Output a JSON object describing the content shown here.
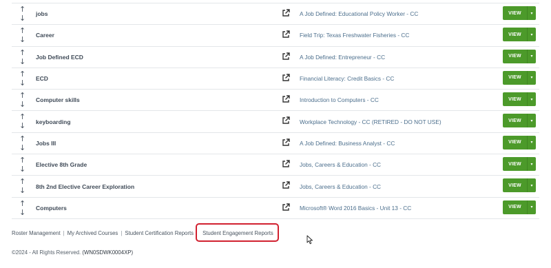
{
  "rows": [
    {
      "name": "jobs",
      "course": "A Job Defined: Educational Policy Worker - CC",
      "view_label": "VIEW"
    },
    {
      "name": "Career",
      "course": "Field Trip: Texas Freshwater Fisheries - CC",
      "view_label": "VIEW"
    },
    {
      "name": "Job Defined ECD",
      "course": "A Job Defined: Entrepreneur - CC",
      "view_label": "VIEW"
    },
    {
      "name": "ECD",
      "course": "Financial Literacy: Credit Basics - CC",
      "view_label": "VIEW"
    },
    {
      "name": "Computer skills",
      "course": "Introduction to Computers - CC",
      "view_label": "VIEW"
    },
    {
      "name": "keyboarding",
      "course": "Workplace Technology - CC (RETIRED - DO NOT USE)",
      "view_label": "VIEW"
    },
    {
      "name": "Jobs III",
      "course": "A Job Defined: Business Analyst - CC",
      "view_label": "VIEW"
    },
    {
      "name": "Elective 8th Grade",
      "course": "Jobs, Careers & Education - CC",
      "view_label": "VIEW"
    },
    {
      "name": "8th 2nd Elective Career Exploration",
      "course": "Jobs, Careers & Education - CC",
      "view_label": "VIEW"
    },
    {
      "name": "Computers",
      "course": "Microsoft® Word 2016 Basics - Unit 13 - CC",
      "view_label": "VIEW"
    }
  ],
  "icons": {
    "sort_up": "↑",
    "sort_down": "↓",
    "external": "external-link-icon",
    "caret": "▾"
  },
  "footer": {
    "links": [
      "Roster Management",
      "My Archived Courses",
      "Student Certification Reports",
      "Student Engagement Reports"
    ],
    "separator": "|",
    "copyright": "©2024 - All Rights Reserved.",
    "code": "(WN0SDWK0004XP)"
  },
  "colors": {
    "view_button": "#4c9a2a",
    "course_link": "#4b6e8c",
    "highlight": "#d1202f"
  }
}
